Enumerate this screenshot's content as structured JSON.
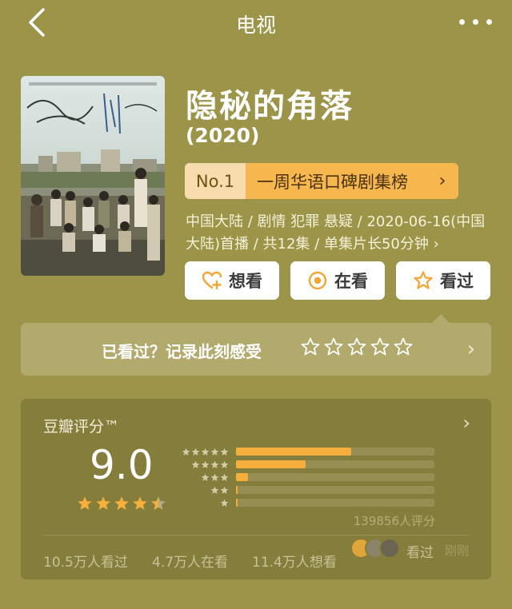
{
  "header": {
    "title": "电视",
    "back_icon": "chevron-left-icon",
    "more_icon": "more-dots-icon"
  },
  "show": {
    "title": "隐秘的角落",
    "year": "(2020)",
    "poster_icon": "poster-image"
  },
  "rank": {
    "no": "No.1",
    "text": "一周华语口碑剧集榜",
    "arrow": "›"
  },
  "meta": {
    "text": "中国大陆 / 剧情 犯罪 悬疑 / 2020-06-16(中国大陆)首播 / 共12集 / 单集片长50分钟 ›"
  },
  "actions": [
    {
      "label": "想看",
      "icon": "heart-plus-icon"
    },
    {
      "label": "在看",
      "icon": "target-circle-icon"
    },
    {
      "label": "看过",
      "icon": "star-outline-icon"
    }
  ],
  "watched": {
    "prompt": "已看过？记录此刻感受",
    "arrow": "›",
    "star_count": 5
  },
  "rating": {
    "label": "豆瓣评分™",
    "arrow": "›",
    "score": "9.0",
    "star_rating": 4.5,
    "distribution": [
      {
        "stars": 5,
        "fraction": 0.58
      },
      {
        "stars": 4,
        "fraction": 0.35
      },
      {
        "stars": 3,
        "fraction": 0.06
      },
      {
        "stars": 2,
        "fraction": 0.008
      },
      {
        "stars": 1,
        "fraction": 0.002
      }
    ],
    "votes": "139856人评分",
    "stats": {
      "watched": "10.5万人看过",
      "watching": "4.7万人在看",
      "want": "11.4万人想看"
    },
    "friends_label": "看过",
    "friends_sub": "刚刚"
  },
  "colors": {
    "background": "#9c9448",
    "accent": "#f6b74f",
    "star": "#f6ae3d"
  }
}
